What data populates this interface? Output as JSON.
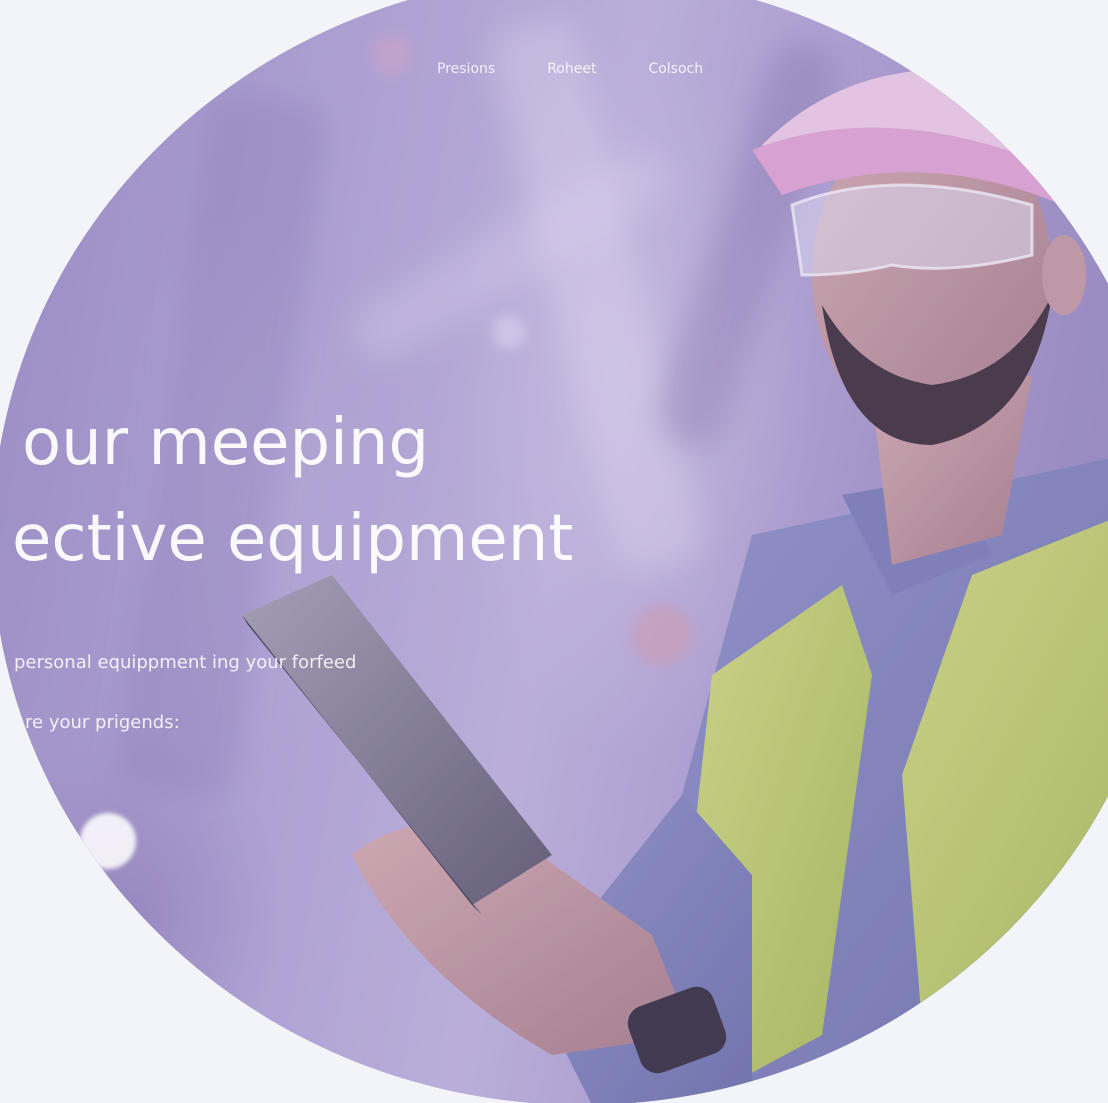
{
  "nav": {
    "items": [
      {
        "label": "Presions"
      },
      {
        "label": "Roheet"
      },
      {
        "label": "Colsoch"
      }
    ]
  },
  "hero": {
    "headline_line1": "our meeping",
    "headline_line2": "ective equipment",
    "subtext_line1": "personal equippment ing your forfeed",
    "subtext_line2": "are your prigends:"
  },
  "colors": {
    "page_background": "#f3f4f9",
    "overlay_purple": "#a79bc8",
    "vest_yellow": "#c9dc63",
    "helmet_pink": "#e6a9d3"
  }
}
